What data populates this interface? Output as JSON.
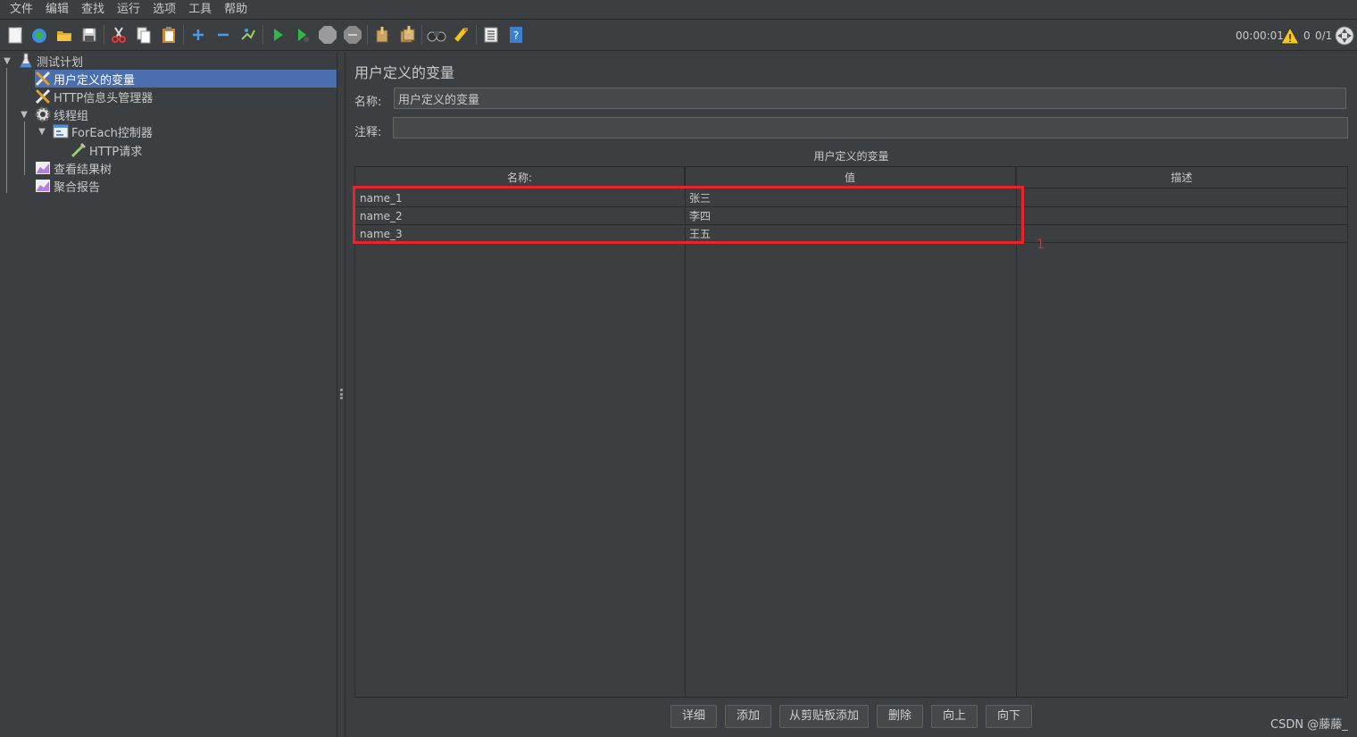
{
  "menu": [
    "文件",
    "编辑",
    "查找",
    "运行",
    "选项",
    "工具",
    "帮助"
  ],
  "toolbar": {
    "icons": [
      "new-icon",
      "templates-icon",
      "open-icon",
      "save-icon",
      "cut-icon",
      "copy-icon",
      "paste-icon",
      "expand-icon",
      "collapse-icon",
      "toggle-icon",
      "start-icon",
      "start-no-pause-icon",
      "stop-icon",
      "shutdown-icon",
      "clear-icon",
      "clear-all-icon",
      "search-icon",
      "reset-search-icon",
      "function-helper-icon",
      "help-icon"
    ],
    "timer": "00:00:01",
    "warning_count": "0",
    "threads": "0/1"
  },
  "tree": {
    "root": "测试计划",
    "items": [
      {
        "label": "用户定义的变量",
        "icon": "wrench-icon",
        "selected": true
      },
      {
        "label": "HTTP信息头管理器",
        "icon": "wrench-icon",
        "selected": false
      },
      {
        "label": "线程组",
        "icon": "gear-icon",
        "selected": false
      },
      {
        "label": "ForEach控制器",
        "icon": "controller-icon",
        "selected": false
      },
      {
        "label": "HTTP请求",
        "icon": "pipette-icon",
        "selected": false
      },
      {
        "label": "查看结果树",
        "icon": "graph-icon",
        "selected": false
      },
      {
        "label": "聚合报告",
        "icon": "graph-icon",
        "selected": false
      }
    ]
  },
  "panel": {
    "title": "用户定义的变量",
    "name_label": "名称:",
    "name_value": "用户定义的变量",
    "comment_label": "注释:",
    "comment_value": "",
    "table_caption": "用户定义的变量",
    "columns": [
      "名称:",
      "值",
      "描述"
    ],
    "rows": [
      {
        "name": "name_1",
        "value": "张三",
        "desc": ""
      },
      {
        "name": "name_2",
        "value": "李四",
        "desc": ""
      },
      {
        "name": "name_3",
        "value": "王五",
        "desc": ""
      }
    ],
    "annotation_mark": "1",
    "buttons": [
      "详细",
      "添加",
      "从剪贴板添加",
      "删除",
      "向上",
      "向下"
    ]
  },
  "watermark": "CSDN @藤藤_",
  "colors": {
    "selection": "#4b6eaf",
    "highlight": "#e8232a",
    "background": "#3c3f41"
  }
}
